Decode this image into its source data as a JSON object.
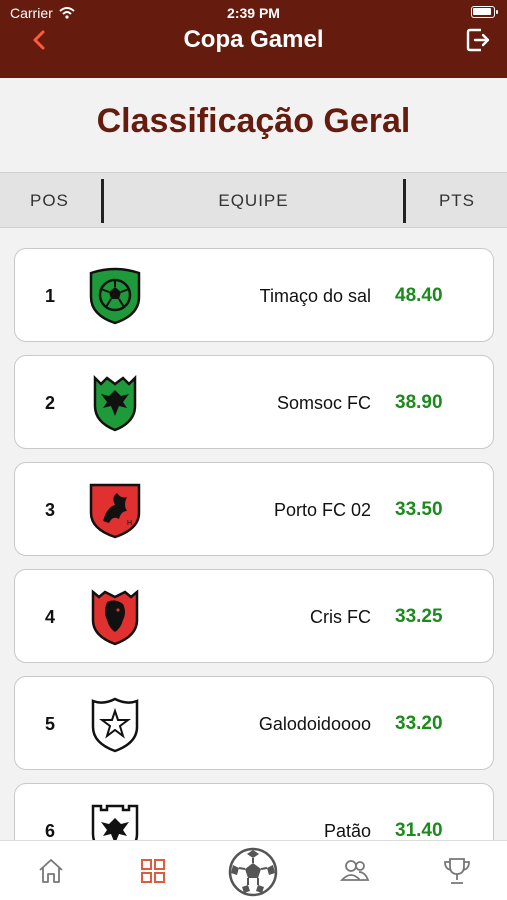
{
  "status_bar": {
    "carrier": "Carrier",
    "time": "2:39 PM"
  },
  "header": {
    "title": "Copa Gamel",
    "back_icon": "chevron-left-icon",
    "logout_icon": "logout-icon"
  },
  "page": {
    "title": "Classificação Geral"
  },
  "columns": {
    "pos": "POS",
    "team": "EQUIPE",
    "pts": "PTS"
  },
  "colors": {
    "header_bg": "#651c0f",
    "title": "#651c0f",
    "points": "#1c8a1c",
    "accent_active_tab": "#e05a3c",
    "crest_green": "#1f9a3a",
    "crest_red": "#e03030"
  },
  "standings": [
    {
      "pos": "1",
      "team": "Timaço do sal",
      "pts": "48.40",
      "crest": "green-soccer-ball-crest-icon"
    },
    {
      "pos": "2",
      "team": "Somsoc FC",
      "pts": "38.90",
      "crest": "green-eagle-crest-icon"
    },
    {
      "pos": "3",
      "team": "Porto FC 02",
      "pts": "33.50",
      "crest": "red-dragon-crest-icon"
    },
    {
      "pos": "4",
      "team": "Cris FC",
      "pts": "33.25",
      "crest": "red-lion-crest-icon"
    },
    {
      "pos": "5",
      "team": "Galodoidoooo",
      "pts": "33.20",
      "crest": "white-star-crest-icon"
    },
    {
      "pos": "6",
      "team": "Patão",
      "pts": "31.40",
      "crest": "white-eagle-crest-icon"
    }
  ],
  "tabs": [
    {
      "icon": "home-icon",
      "active": false
    },
    {
      "icon": "grid-icon",
      "active": true
    },
    {
      "icon": "soccer-ball-icon",
      "active": false
    },
    {
      "icon": "people-icon",
      "active": false
    },
    {
      "icon": "trophy-icon",
      "active": false
    }
  ]
}
